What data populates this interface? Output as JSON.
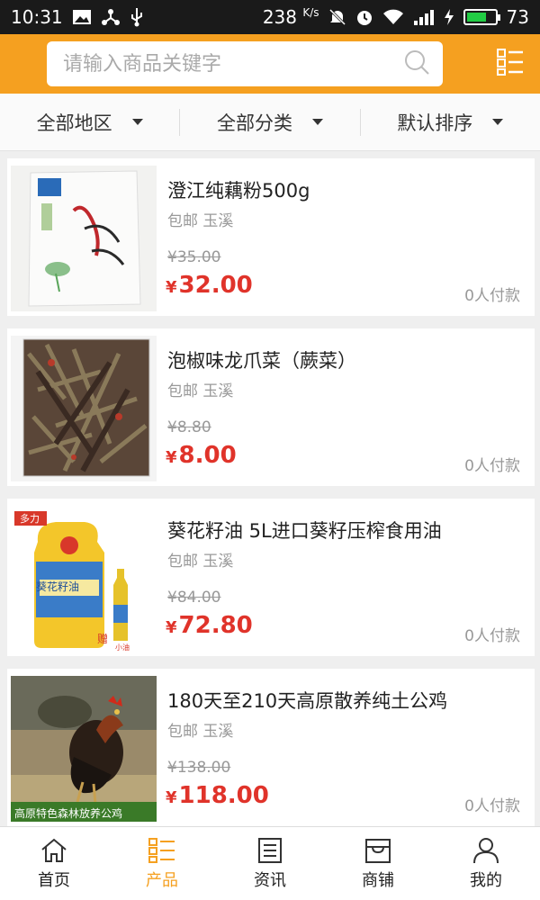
{
  "status_bar": {
    "time": "10:31",
    "speed": "238",
    "speed_unit": "K/s",
    "battery": "73",
    "battery_level": 0.73,
    "icons": [
      "image-icon",
      "share-icon",
      "usb-icon",
      "mute-icon",
      "alarm-icon",
      "wifi-icon",
      "signal-icon",
      "charging-icon",
      "battery-icon"
    ]
  },
  "search": {
    "placeholder": "请输入商品关键字"
  },
  "filters": [
    {
      "label": "全部地区"
    },
    {
      "label": "全部分类"
    },
    {
      "label": "默认排序"
    }
  ],
  "products": [
    {
      "name": "澄江纯藕粉500g",
      "tags": "包邮 玉溪",
      "original_price": "¥35.00",
      "currency": "¥",
      "price": "32.00",
      "sold": "0人付款",
      "image": "lotus-root-powder-package"
    },
    {
      "name": "泡椒味龙爪菜（蕨菜）",
      "tags": "包邮 玉溪",
      "original_price": "¥8.80",
      "currency": "¥",
      "price": "8.00",
      "sold": "0人付款",
      "image": "pickled-fern-package"
    },
    {
      "name": "葵花籽油 5L进口葵籽压榨食用油",
      "tags": "包邮 玉溪",
      "original_price": "¥84.00",
      "currency": "¥",
      "price": "72.80",
      "sold": "0人付款",
      "image": "sunflower-oil-bottles",
      "image_text": {
        "brand": "多力",
        "label": "葵花籽油",
        "gift": "赠",
        "gift_size": "小油"
      }
    },
    {
      "name": "180天至210天高原散养纯土公鸡",
      "tags": "包邮 玉溪",
      "original_price": "¥138.00",
      "currency": "¥",
      "price": "118.00",
      "sold": "0人付款",
      "image": "free-range-rooster",
      "image_caption": "高原特色森林放养公鸡"
    }
  ],
  "tabbar": [
    {
      "label": "首页",
      "icon": "home-icon",
      "active": false
    },
    {
      "label": "产品",
      "icon": "product-list-icon",
      "active": true
    },
    {
      "label": "资讯",
      "icon": "news-icon",
      "active": false
    },
    {
      "label": "商铺",
      "icon": "store-icon",
      "active": false
    },
    {
      "label": "我的",
      "icon": "user-icon",
      "active": false
    }
  ],
  "colors": {
    "accent": "#f5a020",
    "price": "#e0332a",
    "muted": "#999999",
    "background": "#efefef"
  }
}
